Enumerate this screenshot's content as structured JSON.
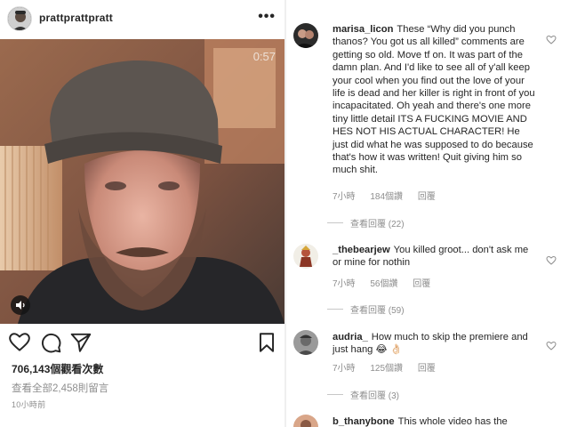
{
  "post": {
    "username": "prattprattpratt",
    "more_label": "•••",
    "video_timer": "0:57",
    "views": "706,143個觀看次數",
    "view_all_comments": "查看全部2,458則留言",
    "time_ago": "10小時前",
    "icons": [
      "heart-icon",
      "comment-icon",
      "share-icon",
      "bookmark-icon",
      "mute-icon"
    ]
  },
  "comments": [
    {
      "username": "marisa_licon",
      "text": "These “Why did you punch thanos? You got us all killed” comments are getting so old. Move tf on. It was part of the damn plan. And I'd like to see all of y'all keep your cool when you find out the love of your life is dead and her killer is right in front of you incapacitated. Oh yeah and there's one more tiny little detail ITS A FUCKING MOVIE AND HES NOT HIS ACTUAL CHARACTER! He just did what he was supposed to do because that's how it was written! Quit giving him so much shit.",
      "time": "7小時",
      "likes": "184個讚",
      "reply": "回覆",
      "view_replies": "查看回覆 (22)"
    },
    {
      "username": "_thebearjew",
      "text": "You killed groot... don't ask me or mine for nothin",
      "time": "7小時",
      "likes": "56個讚",
      "reply": "回覆",
      "view_replies": "查看回覆 (59)"
    },
    {
      "username": "audria_",
      "text": "How much to skip the premiere and just hang 😂 👌🏻",
      "time": "7小時",
      "likes": "125個讚",
      "reply": "回覆",
      "view_replies": "查看回覆 (3)"
    },
    {
      "username": "b_thanybone",
      "text": "This whole video has the"
    }
  ],
  "colors": {
    "text": "#262626",
    "muted": "#8e8e8e",
    "divider": "#efefef"
  }
}
